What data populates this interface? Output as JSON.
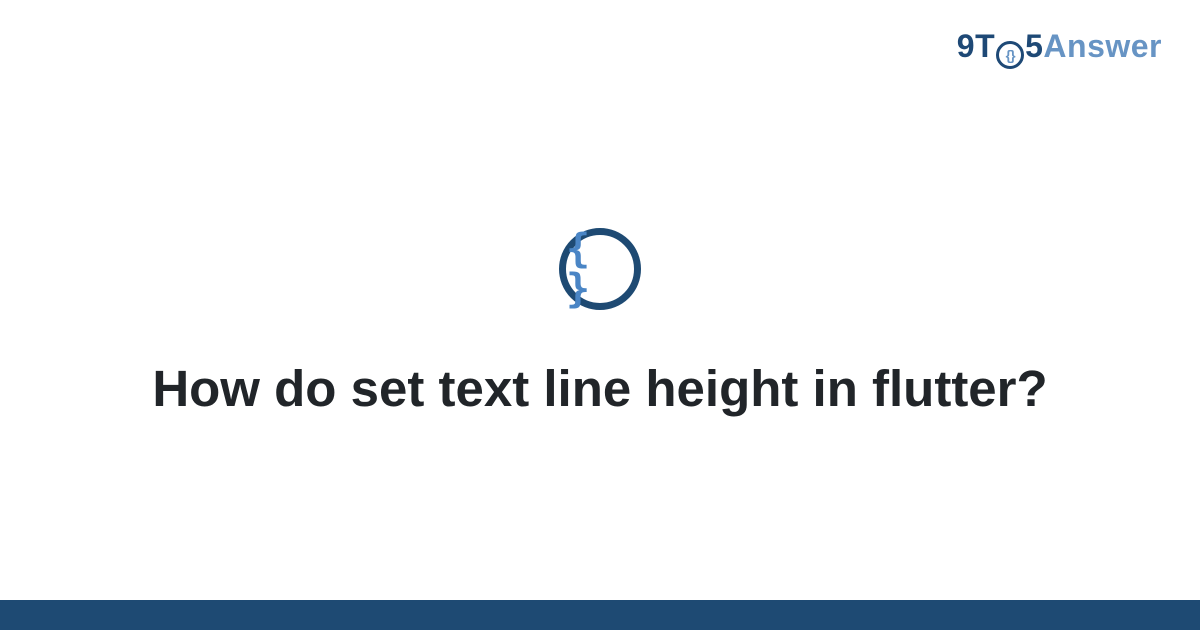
{
  "logo": {
    "part1": "9T",
    "circle_inner": "{}",
    "part2": "5",
    "part3": "Answer"
  },
  "center_icon": {
    "glyph": "{ }"
  },
  "question": {
    "title": "How do set text line height in flutter?"
  },
  "colors": {
    "brand_dark": "#1e4976",
    "brand_light": "#6794c4",
    "bar": "#1e4a73"
  }
}
